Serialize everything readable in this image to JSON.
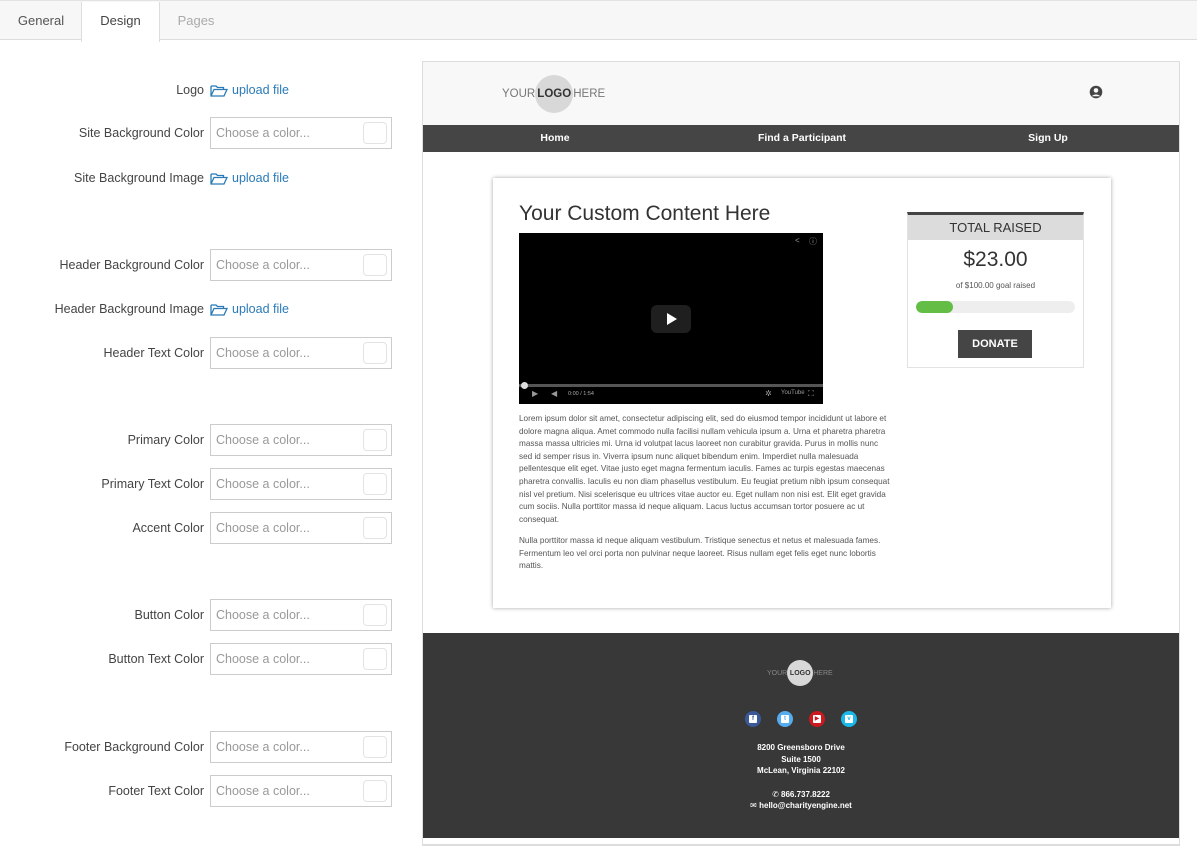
{
  "tabs": [
    {
      "label": "General"
    },
    {
      "label": "Design"
    },
    {
      "label": "Pages"
    }
  ],
  "form": {
    "upload_label": "upload file",
    "color_placeholder": "Choose a color...",
    "fields": {
      "logo": "Logo",
      "site_bg_color": "Site Background Color",
      "site_bg_image": "Site Background Image",
      "header_bg_color": "Header Background Color",
      "header_bg_image": "Header Background Image",
      "header_text_color": "Header Text Color",
      "primary_color": "Primary Color",
      "primary_text_color": "Primary Text Color",
      "accent_color": "Accent Color",
      "button_color": "Button Color",
      "button_text_color": "Button Text Color",
      "footer_bg_color": "Footer Background Color",
      "footer_text_color": "Footer Text Color"
    }
  },
  "preview": {
    "logo": {
      "left": "YOUR",
      "center": "LOGO",
      "right": "HERE"
    },
    "nav": [
      "Home",
      "Find a Participant",
      "Sign Up"
    ],
    "content_title": "Your Custom Content Here",
    "video": {
      "time": "0:00 / 1:54",
      "brand": "YouTube"
    },
    "paragraphs": [
      "Lorem ipsum dolor sit amet, consectetur adipiscing elit, sed do eiusmod tempor incididunt ut labore et dolore magna aliqua. Amet commodo nulla facilisi nullam vehicula ipsum a. Urna et pharetra pharetra massa massa ultricies mi. Urna id volutpat lacus laoreet non curabitur gravida. Purus in mollis nunc sed id semper risus in. Viverra ipsum nunc aliquet bibendum enim. Imperdiet nulla malesuada pellentesque elit eget. Vitae justo eget magna fermentum iaculis. Fames ac turpis egestas maecenas pharetra convallis. Iaculis eu non diam phasellus vestibulum. Eu feugiat pretium nibh ipsum consequat nisl vel pretium. Nisi scelerisque eu ultrices vitae auctor eu. Eget nullam non nisi est. Elit eget gravida cum sociis. Nulla porttitor massa id neque aliquam. Lacus luctus accumsan tortor posuere ac ut consequat.",
      "Nulla porttitor massa id neque aliquam vestibulum. Tristique senectus et netus et malesuada fames. Fermentum leo vel orci porta non pulvinar neque laoreet. Risus nullam eget felis eget nunc lobortis mattis."
    ],
    "fundraising": {
      "heading": "TOTAL RAISED",
      "amount": "$23.00",
      "goal": "of $100.00 goal raised",
      "progress_percent": 23,
      "donate_label": "DONATE"
    },
    "footer": {
      "socials": [
        "facebook-icon",
        "twitter-icon",
        "youtube-icon",
        "vimeo-icon"
      ],
      "social_colors": [
        "#3b5998",
        "#55acee",
        "#cc181e",
        "#1ab7ea"
      ],
      "address1": "8200 Greensboro Drive",
      "address2": "Suite 1500",
      "address3": "McLean, Virginia 22102",
      "phone": "866.737.8222",
      "email": "hello@charityengine.net"
    }
  }
}
